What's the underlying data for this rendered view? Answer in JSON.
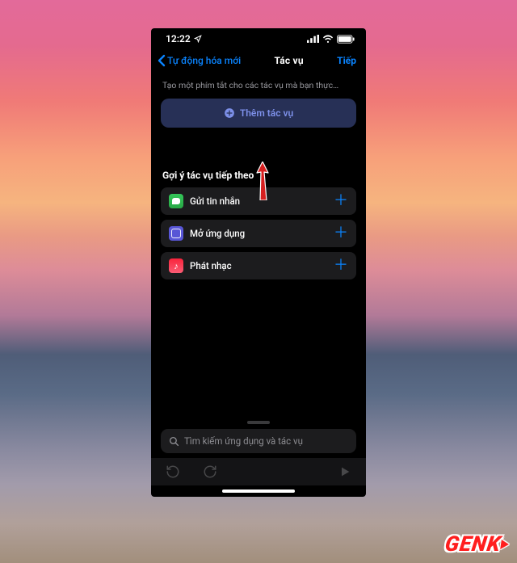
{
  "status": {
    "time": "12:22"
  },
  "nav": {
    "back": "Tự động hóa mới",
    "title": "Tác vụ",
    "next": "Tiếp"
  },
  "hint": "Tạo một phím tắt cho các tác vụ mà bạn thực…",
  "add_button": "Thêm tác vụ",
  "suggestions": {
    "title": "Gợi ý tác vụ tiếp theo",
    "items": [
      {
        "label": "Gửi tin nhắn",
        "icon": "messages"
      },
      {
        "label": "Mở ứng dụng",
        "icon": "shortcuts"
      },
      {
        "label": "Phát nhạc",
        "icon": "music"
      }
    ]
  },
  "search": {
    "placeholder": "Tìm kiếm ứng dụng và tác vụ"
  },
  "watermark": "GENK"
}
